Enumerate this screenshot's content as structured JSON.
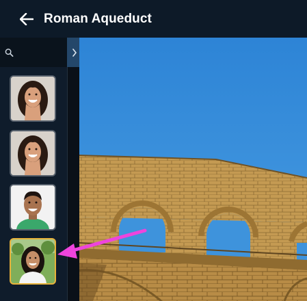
{
  "header": {
    "title": "Roman Aqueduct",
    "back_icon": "arrow-left-icon"
  },
  "search": {
    "value": "",
    "placeholder": "",
    "icon": "search-icon"
  },
  "sidebar": {
    "expand_icon": "chevron-right-icon",
    "thumbnails": [
      {
        "name": "thumbnail-woman-curly-hair-1",
        "selected": false
      },
      {
        "name": "thumbnail-woman-curly-hair-2",
        "selected": false
      },
      {
        "name": "thumbnail-man-smiling",
        "selected": false
      },
      {
        "name": "thumbnail-girl-outdoors",
        "selected": true
      }
    ]
  },
  "colors": {
    "header_bg": "#0d1a28",
    "selected_border": "#e8b23a",
    "annotation_arrow": "#ee44dd",
    "sky": "#2f86d4"
  }
}
